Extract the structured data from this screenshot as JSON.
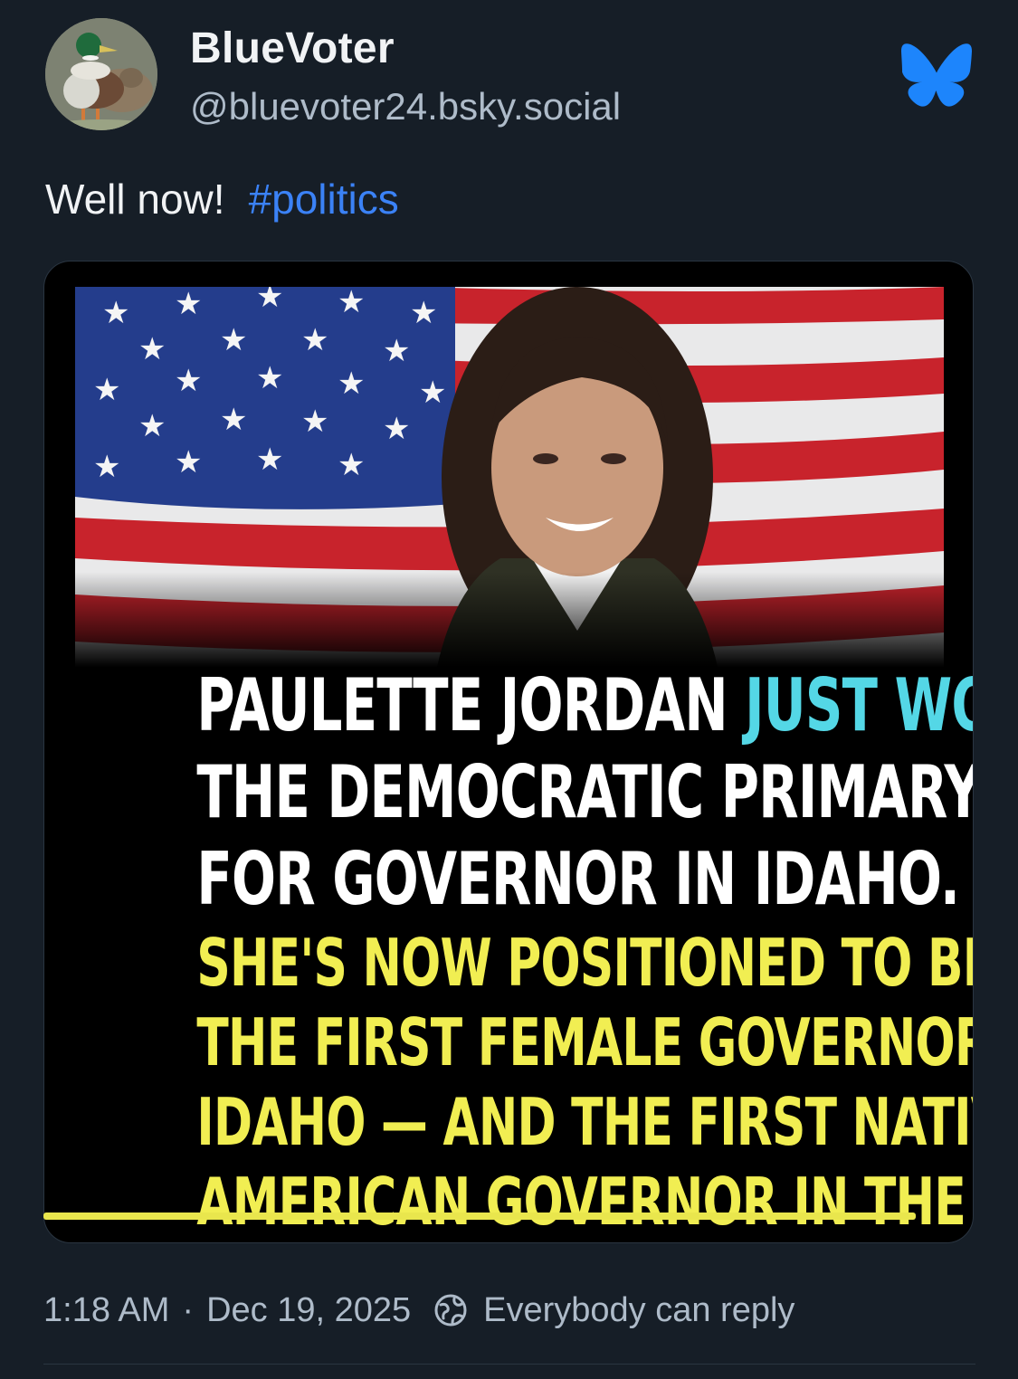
{
  "author": {
    "display_name": "BlueVoter",
    "handle": "@bluevoter24.bsky.social",
    "avatar_icon": "avatar-duck-photo"
  },
  "post": {
    "text": "Well now!",
    "hashtag": "#politics"
  },
  "image": {
    "headline_white_1": "PAULETTE JORDAN",
    "headline_cyan": "JUST WON",
    "headline_white_2": "THE DEMOCRATIC PRIMARY",
    "headline_white_3": "FOR GOVERNOR IN IDAHO.",
    "headline_yellow_1": "SHE'S NOW POSITIONED TO BECOME",
    "headline_yellow_2": "THE FIRST FEMALE GOVERNOR OF",
    "headline_yellow_3": "IDAHO — AND THE FIRST NATIVE",
    "headline_yellow_4": "AMERICAN GOVERNOR IN THE U.S."
  },
  "meta": {
    "time": "1:18 AM",
    "separator": "·",
    "date": "Dec 19, 2025",
    "reply_setting": "Everybody can reply"
  },
  "colors": {
    "background": "#161e27",
    "accent": "#3b82f6",
    "muted": "#aebbc9",
    "headline_cyan": "#54d7e6",
    "headline_yellow": "#f1ee52"
  },
  "icons": {
    "brand": "bluesky-butterfly-icon",
    "reply": "globe-reply-icon"
  }
}
